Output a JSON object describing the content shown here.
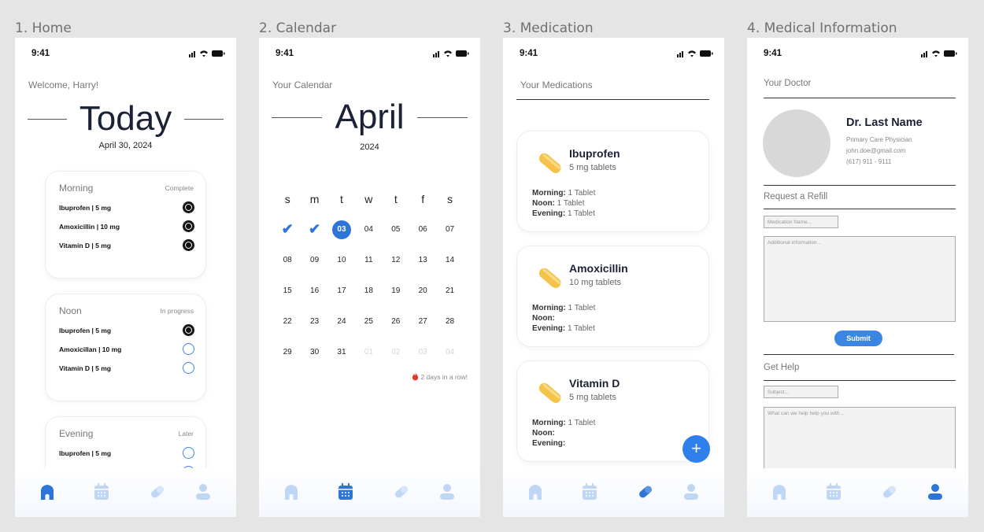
{
  "frames": [
    {
      "title": "1. Home"
    },
    {
      "title": "2. Calendar"
    },
    {
      "title": "3. Medication"
    },
    {
      "title": "4. Medical Information"
    }
  ],
  "status_time": "9:41",
  "home": {
    "greeting": "Welcome, Harry!",
    "heading": "Today",
    "date": "April 30, 2024",
    "cards": [
      {
        "title": "Morning",
        "status": "Complete",
        "items": [
          {
            "name": "Ibuprofen | 5 mg",
            "taken": true
          },
          {
            "name": "Amoxicillin | 10 mg",
            "taken": true
          },
          {
            "name": "Vitamin D | 5 mg",
            "taken": true
          }
        ]
      },
      {
        "title": "Noon",
        "status": "In progress",
        "items": [
          {
            "name": "Ibuprofen | 5 mg",
            "taken": true
          },
          {
            "name": "Amoxicillan | 10 mg",
            "taken": false
          },
          {
            "name": "Vitamin D | 5 mg",
            "taken": false
          }
        ]
      },
      {
        "title": "Evening",
        "status": "Later",
        "items": [
          {
            "name": "Ibuprofen | 5 mg",
            "taken": false
          }
        ]
      }
    ]
  },
  "calendar": {
    "label": "Your Calendar",
    "month": "April",
    "year": "2024",
    "weekdays": [
      "s",
      "m",
      "t",
      "w",
      "t",
      "f",
      "s"
    ],
    "weeks": [
      [
        "✔",
        "✔",
        "03",
        "04",
        "05",
        "06",
        "07"
      ],
      [
        "08",
        "09",
        "10",
        "11",
        "12",
        "13",
        "14"
      ],
      [
        "15",
        "16",
        "17",
        "18",
        "19",
        "20",
        "21"
      ],
      [
        "22",
        "23",
        "24",
        "25",
        "26",
        "27",
        "28"
      ],
      [
        "29",
        "30",
        "31",
        "01",
        "02",
        "03",
        "04"
      ]
    ],
    "today": "03",
    "streak": "2 days in a row!"
  },
  "medication": {
    "label": "Your Medications",
    "items": [
      {
        "name": "Ibuprofen",
        "type": "5 mg tablets",
        "morning": "1 Tablet",
        "noon": "1 Tablet",
        "evening": "1 Tablet"
      },
      {
        "name": "Amoxicillin",
        "type": "10 mg tablets",
        "morning": "1 Tablet",
        "noon": "",
        "evening": "1 Tablet"
      },
      {
        "name": "Vitamin D",
        "type": "5 mg tablets",
        "morning": "1 Tablet",
        "noon": "",
        "evening": ""
      }
    ],
    "labels": {
      "morning": "Morning:",
      "noon": "Noon:",
      "evening": "Evening:"
    },
    "add_label": "+"
  },
  "medical": {
    "doctor_label": "Your Doctor",
    "doctor_name": "Dr. Last Name",
    "doctor_role": "Primary Care Physician",
    "doctor_email": "john.doe@gmail.com",
    "doctor_phone": "(617) 911 - 9111",
    "refill_label": "Request a Refill",
    "med_name_placeholder": "Medication Name...",
    "additional_placeholder": "Additional information...",
    "submit_label": "Submit",
    "help_label": "Get Help",
    "subject_placeholder": "Subject...",
    "help_placeholder": "What can we help help you with..."
  },
  "colors": {
    "accent": "#2f75d7",
    "tab_inactive": "#bfd6f5",
    "pill": "#f6c34a"
  }
}
